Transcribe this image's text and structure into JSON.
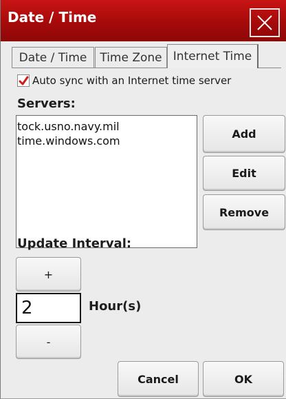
{
  "window": {
    "title": "Date / Time"
  },
  "tabs": [
    {
      "label": "Date / Time",
      "active": false
    },
    {
      "label": "Time Zone",
      "active": false
    },
    {
      "label": "Internet Time",
      "active": true
    }
  ],
  "auto_sync": {
    "label": "Auto sync with an Internet time server",
    "checked": true
  },
  "servers": {
    "label": "Servers:",
    "items": [
      "tock.usno.navy.mil",
      "time.windows.com"
    ],
    "add_label": "Add",
    "edit_label": "Edit",
    "remove_label": "Remove"
  },
  "update_interval": {
    "label": "Update Interval:",
    "increment_label": "+",
    "decrement_label": "-",
    "value": "2",
    "unit": "Hour(s)"
  },
  "footer": {
    "cancel_label": "Cancel",
    "ok_label": "OK"
  },
  "colors": {
    "titlebar": "#b00d0d",
    "checkmark": "#d11a1a",
    "background": "#ececec"
  },
  "icons": {
    "close": "close-icon",
    "check": "checkmark-icon"
  }
}
